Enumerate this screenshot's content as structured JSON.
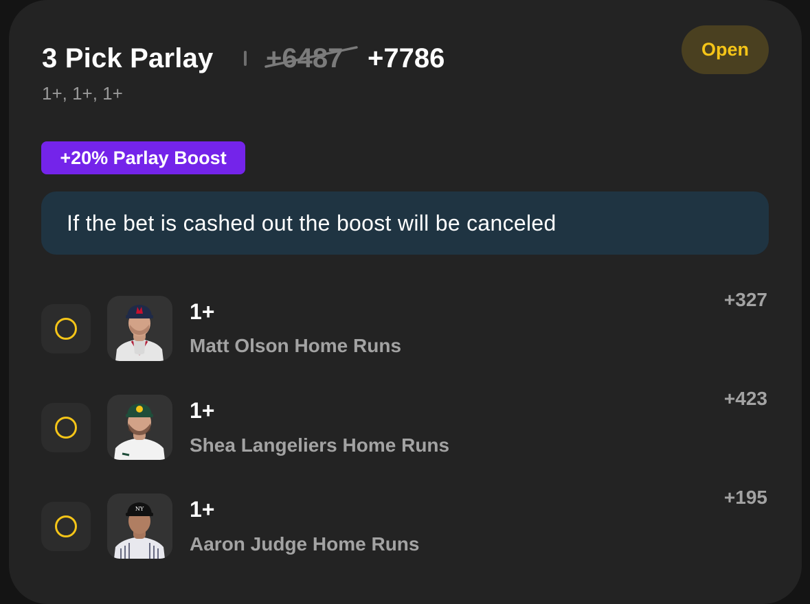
{
  "header": {
    "title": "3 Pick Parlay",
    "old_odds": "+6487",
    "new_odds": "+7786",
    "subtitle": "1+, 1+, 1+",
    "status": "Open"
  },
  "boost": {
    "label": "+20% Parlay Boost",
    "notice": "If the bet is cashed out the boost will be canceled"
  },
  "legs": [
    {
      "line": "1+",
      "market": "Matt Olson Home Runs",
      "odds": "+327",
      "team_icon": "braves-cap-icon"
    },
    {
      "line": "1+",
      "market": "Shea Langeliers Home Runs",
      "odds": "+423",
      "team_icon": "athletics-cap-icon"
    },
    {
      "line": "1+",
      "market": "Aaron Judge Home Runs",
      "odds": "+195",
      "team_icon": "yankees-cap-icon"
    }
  ],
  "colors": {
    "card_bg": "#232323",
    "status_text": "#f5c518",
    "status_bg": "#4a4020",
    "boost_bg": "#7424ea",
    "notice_bg": "#1f3442",
    "pending_ring": "#f5c518"
  }
}
